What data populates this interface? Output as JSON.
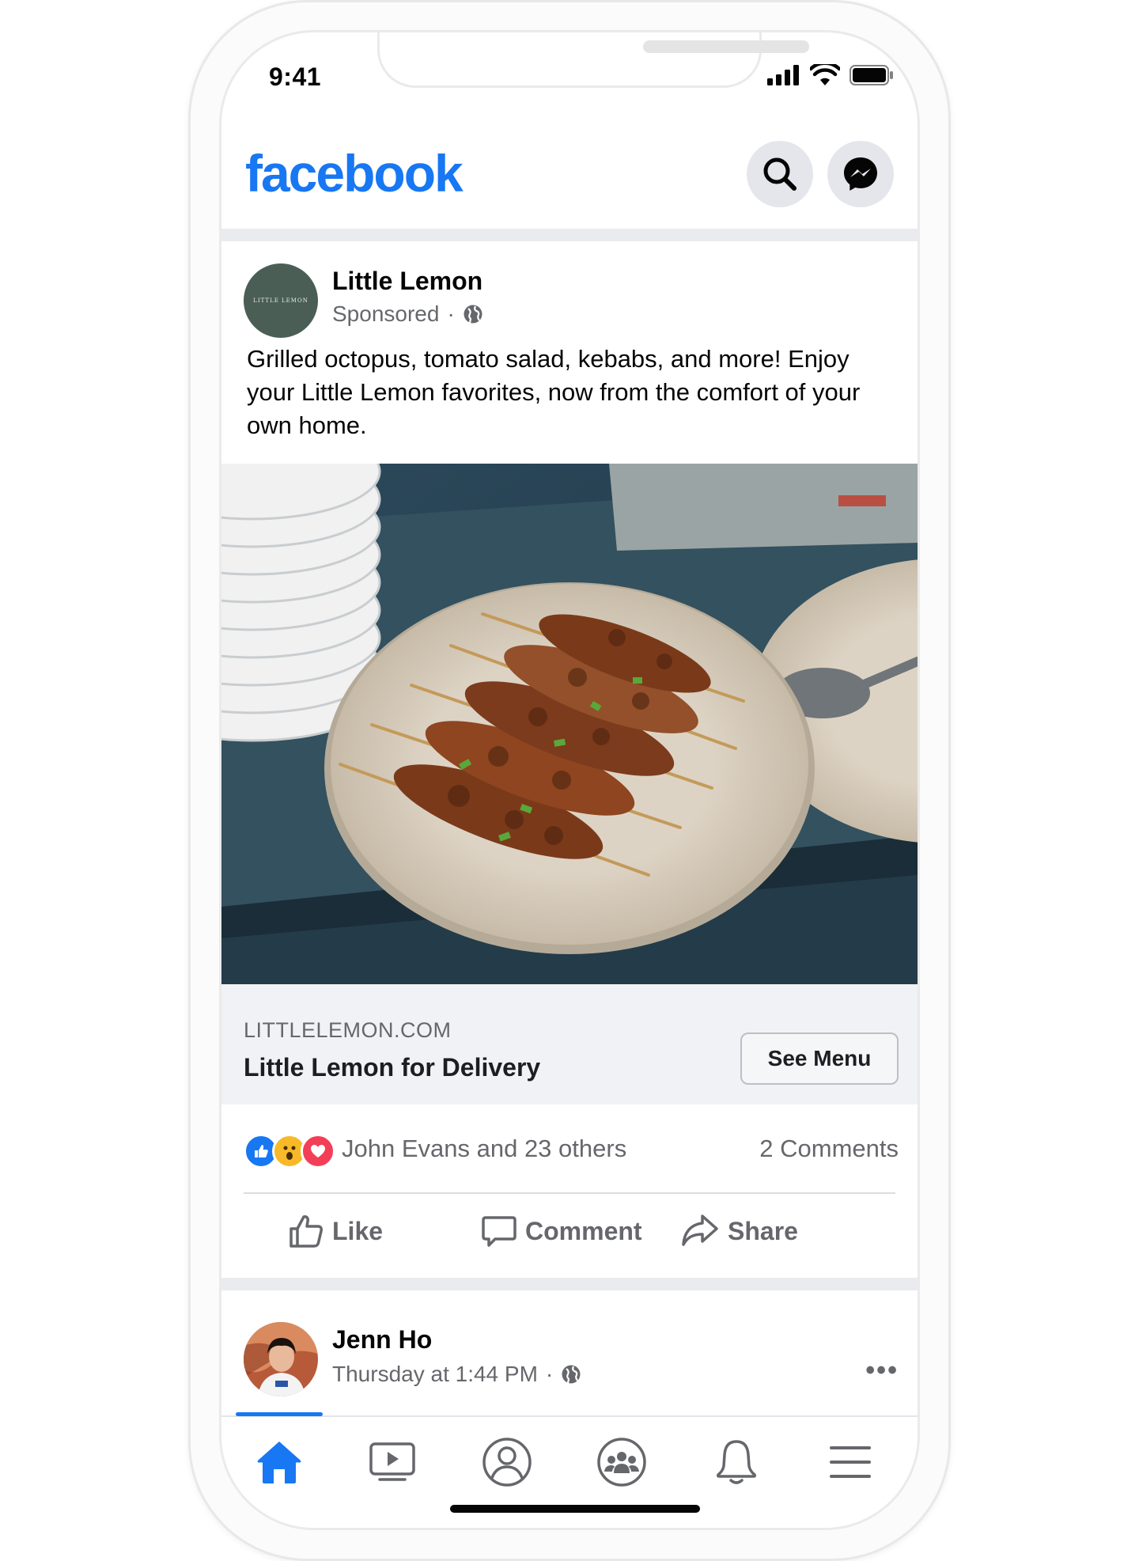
{
  "status_bar": {
    "time": "9:41"
  },
  "header": {
    "logo": "facebook",
    "search_icon": "search-icon",
    "messenger_icon": "messenger-icon"
  },
  "post": {
    "page_name": "Little Lemon",
    "avatar_text": "LITTLE LEMON",
    "meta": "Sponsored",
    "meta_separator": "·",
    "privacy_icon": "globe-icon",
    "text": "Grilled octopus, tomato salad, kebabs, and more! Enjoy your Little Lemon favorites, now from the comfort of your own home.",
    "image_icon": "food-photo-kebabs",
    "link": {
      "domain": "LITTLELEMON.COM",
      "title": "Little Lemon for Delivery",
      "cta": "See Menu"
    },
    "reactions": {
      "icons": [
        "like-reaction-icon",
        "wow-reaction-icon",
        "love-reaction-icon"
      ],
      "text": "John Evans and 23 others",
      "comments": "2 Comments"
    },
    "actions": {
      "like": "Like",
      "comment": "Comment",
      "share": "Share"
    }
  },
  "second_post": {
    "name": "Jenn Ho",
    "meta": "Thursday at 1:44 PM",
    "meta_separator": "·",
    "more": "•••"
  },
  "tabbar": {
    "tabs": [
      "home-icon",
      "watch-icon",
      "profile-icon",
      "groups-icon",
      "notifications-icon",
      "menu-icon"
    ],
    "active": "home-icon"
  },
  "colors": {
    "brand": "#1877f2",
    "secondary_text": "#65676b",
    "background_gray": "#f0f2f5"
  }
}
